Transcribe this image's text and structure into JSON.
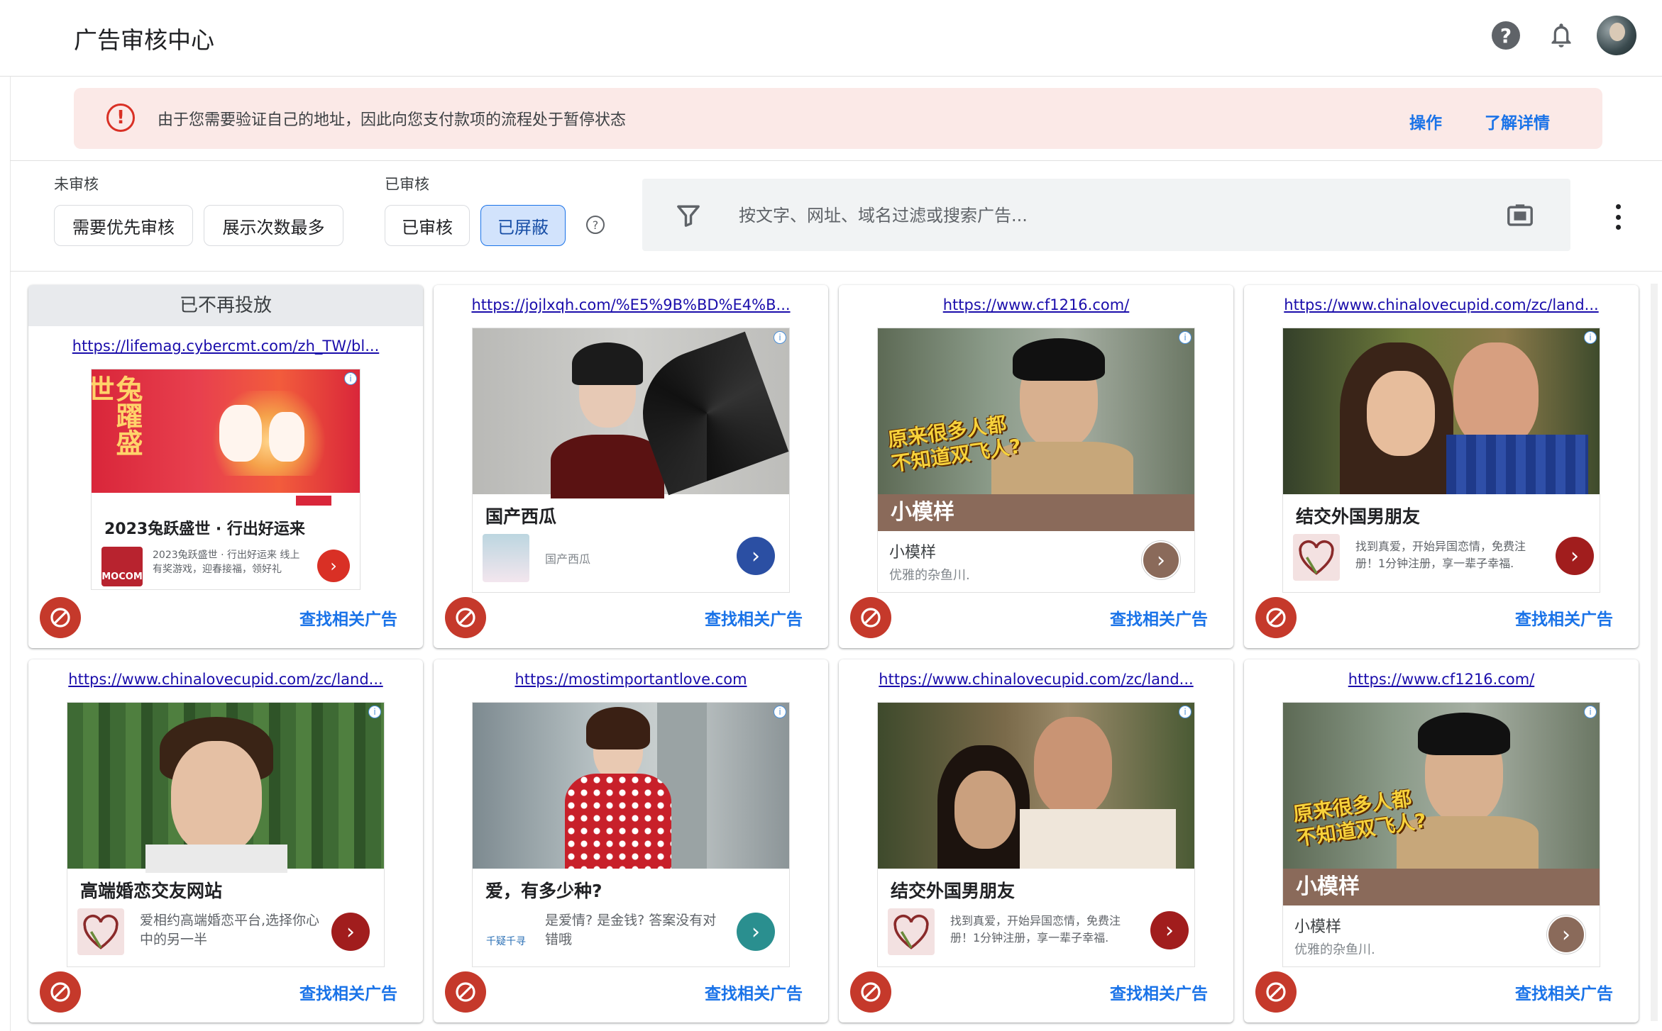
{
  "app": {
    "title": "广告审核中心"
  },
  "banner": {
    "message": "由于您需要验证自己的地址，因此向您支付款项的流程处于暂停状态",
    "action_label": "操作",
    "learn_more_label": "了解详情",
    "color": "#fbe9e7"
  },
  "filters": {
    "unreviewed_label": "未审核",
    "unreviewed_chips": [
      "需要优先审核",
      "展示次数最多"
    ],
    "reviewed_label": "已审核",
    "reviewed_chips": [
      "已审核",
      "已屏蔽"
    ],
    "active_chip": "已屏蔽",
    "search_placeholder": "按文字、网址、域名过滤或搜索广告..."
  },
  "cards": [
    {
      "status": "已不再投放",
      "url": "https://lifemag.cybercmt.com/zh_TW/bl...",
      "headline": "2023兔跃盛世 · 行出好运来",
      "desc": "2023兔跃盛世 · 行出好运来 线上有奖游戏，迎春接福，领好礼",
      "image_text": "兔躍盛世",
      "thumb_text": "MOCOM",
      "find_label": "查找相关广告",
      "go_color": "#d93025"
    },
    {
      "url": "https://jojlxqh.com/%E5%9B%BD%E4%B...",
      "headline": "国产西瓜",
      "desc": "国产西瓜",
      "find_label": "查找相关广告",
      "go_color": "#2b4fa3"
    },
    {
      "url": "https://www.cf1216.com/",
      "overlay": "原来很多人都不知道双飞人?",
      "brand": "小模样",
      "sub1": "小模样",
      "sub2": "优雅的杂鱼川.",
      "find_label": "查找相关广告",
      "go_color": "#8a6a5a"
    },
    {
      "url": "https://www.chinalovecupid.com/zc/land...",
      "headline": "结交外国男朋友",
      "desc": "找到真爱，开始异国恋情，免费注册！1分钟注册，享一辈子幸福.",
      "find_label": "查找相关广告",
      "go_color": "#a11d1d"
    },
    {
      "url": "https://www.chinalovecupid.com/zc/land...",
      "headline": "高端婚恋交友网站",
      "desc": "爱相约高端婚恋平台,选择你心中的另一半",
      "find_label": "查找相关广告",
      "go_color": "#a11d1d"
    },
    {
      "url": "https://mostimportantlove.com",
      "headline": "爱，有多少种?",
      "desc": "是爱情? 是金钱? 答案没有对错哦",
      "thumb_text": "千疑千寻",
      "find_label": "查找相关广告",
      "go_color": "#2a8f8f"
    },
    {
      "url": "https://www.chinalovecupid.com/zc/land...",
      "headline": "结交外国男朋友",
      "desc": "找到真爱，开始异国恋情，免费注册！1分钟注册，享一辈子幸福.",
      "find_label": "查找相关广告",
      "go_color": "#a11d1d"
    },
    {
      "url": "https://www.cf1216.com/",
      "overlay": "原来很多人都不知道双飞人?",
      "brand": "小模样",
      "sub1": "小模样",
      "sub2": "优雅的杂鱼川.",
      "find_label": "查找相关广告",
      "go_color": "#8a6a5a"
    }
  ],
  "colors": {
    "accent": "#1a73e8",
    "block": "#c5392b",
    "active_chip_bg": "#d2e3fc"
  }
}
